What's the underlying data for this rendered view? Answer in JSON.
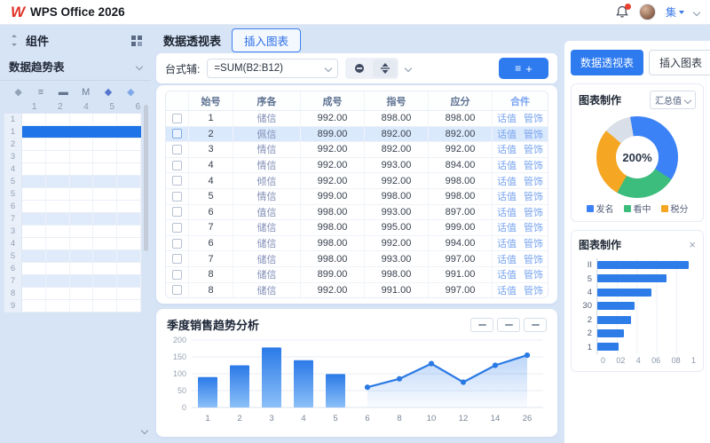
{
  "topbar": {
    "logo": "W",
    "title": "WPS Office 2026",
    "user_label": "集"
  },
  "sidebar": {
    "header_title": "组件",
    "panel_title": "数据趋势表",
    "toolbar_icons": [
      "◆",
      "≡",
      "▬",
      "M",
      "◆",
      "◆"
    ],
    "column_headers": [
      "1",
      "2",
      "4",
      "5",
      "6"
    ],
    "grid_rows": [
      {
        "n": "1"
      },
      {
        "n": "1",
        "state": "selected"
      },
      {
        "n": "2"
      },
      {
        "n": "3"
      },
      {
        "n": "4"
      },
      {
        "n": "5",
        "state": "tint"
      },
      {
        "n": "5"
      },
      {
        "n": "6"
      },
      {
        "n": "7",
        "state": "tint"
      },
      {
        "n": "3"
      },
      {
        "n": "4"
      },
      {
        "n": "5",
        "state": "tint"
      },
      {
        "n": "6"
      },
      {
        "n": "7",
        "state": "tint"
      },
      {
        "n": "8"
      },
      {
        "n": "9"
      }
    ]
  },
  "main": {
    "tab_pivot": "数据透视表",
    "tab_insert": "插入图表",
    "formula_label": "台式辅:",
    "formula_value": "=SUM(B2:B12)",
    "add_button_plus": "+",
    "add_button_bars": "≡",
    "table": {
      "headers": [
        "始号",
        "序各",
        "成号",
        "指号",
        "应分",
        "合件"
      ],
      "action_labels": [
        "话值",
        "管饰"
      ],
      "rows": [
        {
          "id": "1",
          "name": "储信",
          "v1": "992.00",
          "v2": "898.00",
          "v3": "898.00",
          "selected": false
        },
        {
          "id": "2",
          "name": "佩信",
          "v1": "899.00",
          "v2": "892.00",
          "v3": "892.00",
          "selected": true
        },
        {
          "id": "3",
          "name": "情信",
          "v1": "992.00",
          "v2": "892.00",
          "v3": "992.00",
          "selected": false
        },
        {
          "id": "4",
          "name": "情信",
          "v1": "992.00",
          "v2": "993.00",
          "v3": "894.00",
          "selected": false
        },
        {
          "id": "4",
          "name": "倾信",
          "v1": "992.00",
          "v2": "992.00",
          "v3": "998.00",
          "selected": false
        },
        {
          "id": "5",
          "name": "情信",
          "v1": "999.00",
          "v2": "998.00",
          "v3": "998.00",
          "selected": false
        },
        {
          "id": "6",
          "name": "值信",
          "v1": "998.00",
          "v2": "993.00",
          "v3": "897.00",
          "selected": false
        },
        {
          "id": "7",
          "name": "储信",
          "v1": "998.00",
          "v2": "995.00",
          "v3": "999.00",
          "selected": false
        },
        {
          "id": "6",
          "name": "储信",
          "v1": "998.00",
          "v2": "992.00",
          "v3": "994.00",
          "selected": false
        },
        {
          "id": "7",
          "name": "储信",
          "v1": "998.00",
          "v2": "993.00",
          "v3": "997.00",
          "selected": false
        },
        {
          "id": "8",
          "name": "储信",
          "v1": "899.00",
          "v2": "998.00",
          "v3": "991.00",
          "selected": false
        },
        {
          "id": "8",
          "name": "储信",
          "v1": "992.00",
          "v2": "991.00",
          "v3": "997.00",
          "selected": false
        }
      ]
    }
  },
  "right_panel": {
    "pivot_button": "数据透视表",
    "insert_button": "插入图表",
    "donut_card_title": "图表制作",
    "donut_dropdown": "汇总值",
    "bar_card_title": "图表制作",
    "close_label": "×"
  },
  "colors": {
    "accent_blue": "#2e7bf0",
    "bar_blue": "#2b7ae8",
    "donut_blue": "#3b82f6",
    "donut_green": "#3dbd7d",
    "donut_orange": "#f5a623",
    "donut_gray": "#d9dfe8",
    "selected_row": "#dbe9fc"
  },
  "chart_data": [
    {
      "id": "trend",
      "type": "bar",
      "title": "季度销售趋势分析",
      "categories": [
        "1",
        "2",
        "3",
        "4",
        "5",
        "6",
        "8",
        "10",
        "12",
        "14",
        "26"
      ],
      "series": [
        {
          "name": "bars",
          "type": "bar",
          "values": [
            90,
            125,
            178,
            140,
            99,
            null,
            null,
            null,
            null,
            null,
            null
          ]
        },
        {
          "name": "line",
          "type": "line",
          "values": [
            null,
            null,
            null,
            null,
            null,
            60,
            85,
            130,
            75,
            125,
            155
          ]
        }
      ],
      "xlabel": "",
      "ylabel": "",
      "ylim": [
        0,
        200
      ],
      "yticks": [
        0,
        50,
        100,
        150,
        200
      ],
      "grid": true,
      "legend_position": "none",
      "bar_color": "#2b7ae8",
      "line_color": "#2a7ae4"
    },
    {
      "id": "donut",
      "type": "pie",
      "center_label": "200%",
      "slices": [
        {
          "label": "发名",
          "value": 37,
          "color": "#3b82f6"
        },
        {
          "label": "看中",
          "value": 24,
          "color": "#3dbd7d"
        },
        {
          "label": "税分",
          "value": 28,
          "color": "#f5a623"
        },
        {
          "label": "",
          "value": 11,
          "color": "#d9dfe8"
        }
      ],
      "legend_position": "bottom"
    },
    {
      "id": "hbar",
      "type": "bar",
      "orientation": "horizontal",
      "categories": [
        "II",
        "5",
        "4",
        "30",
        "2",
        "2",
        "1"
      ],
      "values": [
        0.93,
        0.7,
        0.55,
        0.38,
        0.34,
        0.27,
        0.22
      ],
      "xticks": [
        "0",
        "02",
        "4",
        "06",
        "08",
        "1"
      ],
      "xlim": [
        0,
        1
      ],
      "grid": true,
      "color": "#2d7ce8"
    }
  ]
}
